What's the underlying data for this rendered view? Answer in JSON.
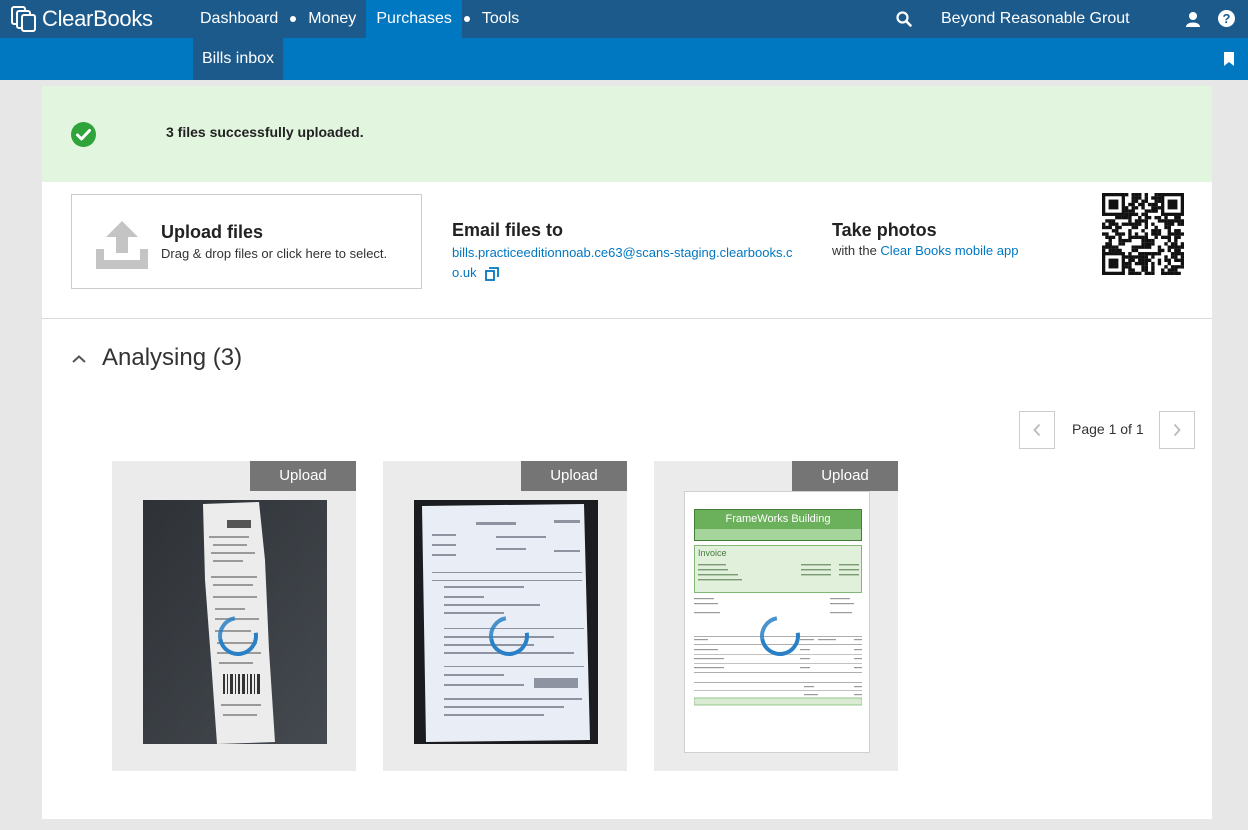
{
  "topbar": {
    "brand": "ClearBooks",
    "nav": [
      {
        "label": "Dashboard"
      },
      {
        "label": "Money"
      },
      {
        "label": "Purchases"
      },
      {
        "label": "Tools"
      }
    ],
    "company": "Beyond Reasonable Grout",
    "help": "?"
  },
  "subnav": {
    "tab": "Bills inbox"
  },
  "banner": {
    "message": "3 files successfully uploaded."
  },
  "upload": {
    "title": "Upload files",
    "subtitle": "Drag & drop files or click here to select."
  },
  "email": {
    "title": "Email files to",
    "address": "bills.practiceeditionnoab.ce63@scans-staging.clearbooks.co.uk"
  },
  "photos": {
    "title": "Take photos",
    "prefix": "with the ",
    "link": "Clear Books mobile app"
  },
  "section": {
    "title": "Analysing (3)"
  },
  "pager": {
    "text": "Page 1 of 1"
  },
  "thumbnails": [
    {
      "button": "Upload",
      "kind": "receipt"
    },
    {
      "button": "Upload",
      "kind": "invoice-photo"
    },
    {
      "button": "Upload",
      "kind": "invoice-digital",
      "doc": {
        "company": "FrameWorks Building",
        "heading": "Invoice"
      }
    }
  ],
  "colors": {
    "topbar": "#1c5a8c",
    "subbar": "#0077c1",
    "success_bg": "#e2f6df",
    "success_icon": "#2ea43a",
    "link": "#0077c1",
    "upload_button": "#757575"
  }
}
